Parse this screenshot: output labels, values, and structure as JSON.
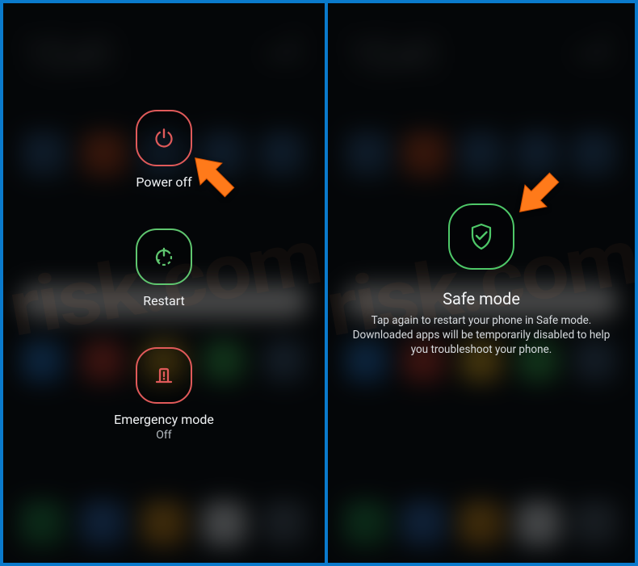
{
  "left": {
    "power_off": {
      "label": "Power off"
    },
    "restart": {
      "label": "Restart"
    },
    "emergency": {
      "label": "Emergency mode",
      "sub": "Off"
    }
  },
  "right": {
    "safe_mode": {
      "title": "Safe mode",
      "desc": "Tap again to restart your phone in Safe mode. Downloaded apps will be temporarily disabled to help you troubleshoot your phone."
    }
  },
  "colors": {
    "red": "#e05a5a",
    "green": "#5fc66f",
    "arrow": "#ff7a1a"
  }
}
